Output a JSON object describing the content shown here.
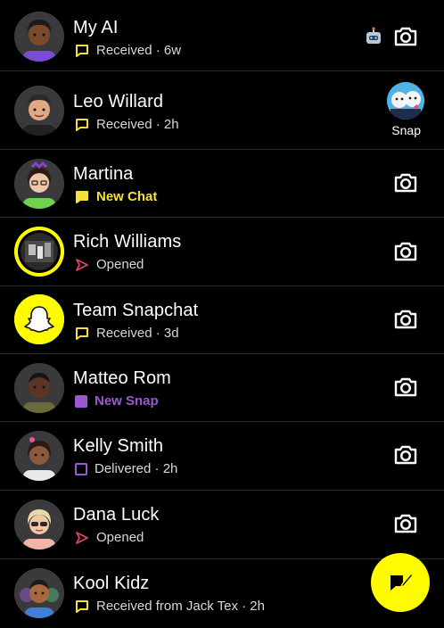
{
  "chats": [
    {
      "name": "My AI",
      "status": "Received · 6w",
      "status_kind": "received",
      "action": "camera",
      "extra_icon": "robot-icon"
    },
    {
      "name": "Leo Willard",
      "status": "Received · 2h",
      "status_kind": "received",
      "action": "snap",
      "snap_label": "Snap"
    },
    {
      "name": "Martina",
      "status": "New Chat",
      "status_kind": "new-chat",
      "action": "camera"
    },
    {
      "name": "Rich Williams",
      "status": "Opened",
      "status_kind": "opened",
      "action": "camera"
    },
    {
      "name": "Team Snapchat",
      "status": "Received · 3d",
      "status_kind": "received",
      "action": "camera"
    },
    {
      "name": "Matteo Rom",
      "status": "New Snap",
      "status_kind": "new-snap",
      "action": "camera"
    },
    {
      "name": "Kelly Smith",
      "status": "Delivered · 2h",
      "status_kind": "delivered",
      "action": "camera"
    },
    {
      "name": "Dana Luck",
      "status": "Opened",
      "status_kind": "opened",
      "action": "camera"
    },
    {
      "name": "Kool Kidz",
      "status": "Received from Jack Tex · 2h",
      "status_kind": "received",
      "action": "none"
    }
  ],
  "colors": {
    "background": "#000000",
    "snap_yellow": "#FFFC00",
    "chat_yellow": "#F7E03A",
    "snap_purple": "#9B59D0",
    "opened_red": "#E0475C",
    "divider": "#2A2A2A"
  },
  "fab": {
    "icon": "new-chat-icon"
  }
}
